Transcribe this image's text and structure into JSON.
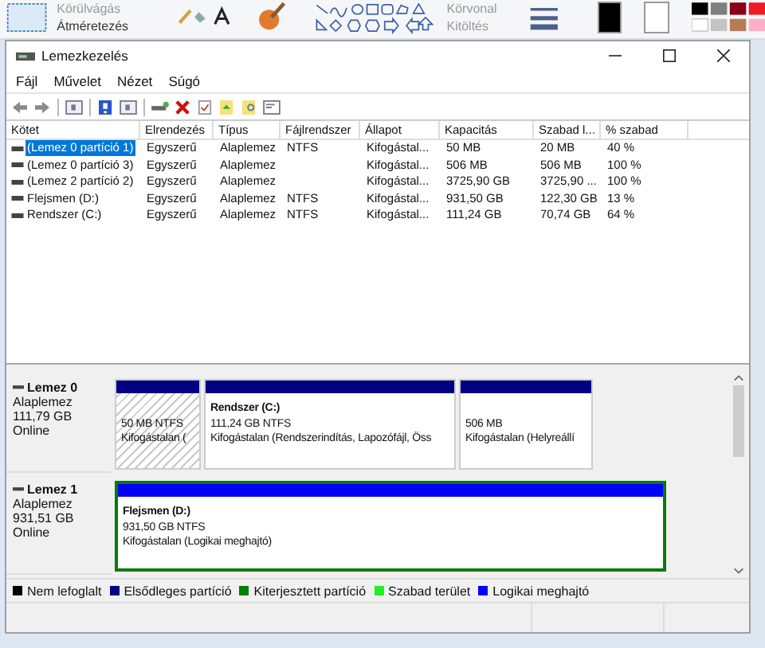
{
  "background_ribbon": {
    "texts": [
      "Körülvágás",
      "Átméretezés",
      "Körvonal",
      "Kitöltés"
    ]
  },
  "window": {
    "title": "Lemezkezelés"
  },
  "menu": [
    "Fájl",
    "Művelet",
    "Nézet",
    "Súgó"
  ],
  "volume_table": {
    "columns": [
      "Kötet",
      "Elrendezés",
      "Típus",
      "Fájlrendszer",
      "Állapot",
      "Kapacitás",
      "Szabad l...",
      "% szabad"
    ],
    "rows": [
      {
        "selected": true,
        "cells": [
          "(Lemez 0 partíció 1)",
          "Egyszerű",
          "Alaplemez",
          "NTFS",
          "Kifogástal...",
          "50 MB",
          "20 MB",
          "40 %"
        ]
      },
      {
        "selected": false,
        "cells": [
          "(Lemez 0 partíció 3)",
          "Egyszerű",
          "Alaplemez",
          "",
          "Kifogástal...",
          "506 MB",
          "506 MB",
          "100 %"
        ]
      },
      {
        "selected": false,
        "cells": [
          "(Lemez 2 partíció 2)",
          "Egyszerű",
          "Alaplemez",
          "",
          "Kifogástal...",
          "3725,90 GB",
          "3725,90 ...",
          "100 %"
        ]
      },
      {
        "selected": false,
        "cells": [
          "Flejsmen (D:)",
          "Egyszerű",
          "Alaplemez",
          "NTFS",
          "Kifogástal...",
          "931,50 GB",
          "122,30 GB",
          "13 %"
        ]
      },
      {
        "selected": false,
        "cells": [
          "Rendszer (C:)",
          "Egyszerű",
          "Alaplemez",
          "NTFS",
          "Kifogástal...",
          "111,24 GB",
          "70,74 GB",
          "64 %"
        ]
      }
    ]
  },
  "disks": [
    {
      "name": "Lemez 0",
      "type": "Alaplemez",
      "size": "111,79 GB",
      "status": "Online",
      "partitions": [
        {
          "kind": "primary",
          "selected": true,
          "size_fs": "50 MB NTFS",
          "status": "Kifogástalan ("
        },
        {
          "kind": "primary",
          "selected": false,
          "label": "Rendszer  (C:)",
          "size_fs": "111,24 GB NTFS",
          "status": "Kifogástalan (Rendszerindítás, Lapozófájl, Öss"
        },
        {
          "kind": "primary",
          "selected": false,
          "size_fs": "506 MB",
          "status": "Kifogástalan (Helyreállí"
        }
      ]
    },
    {
      "name": "Lemez 1",
      "type": "Alaplemez",
      "size": "931,51 GB",
      "status": "Online",
      "partitions": [
        {
          "kind": "extended",
          "children": [
            {
              "kind": "logical",
              "selected": false,
              "label": "Flejsmen  (D:)",
              "size_fs": "931,50 GB NTFS",
              "status": "Kifogástalan (Logikai meghajtó)"
            }
          ]
        }
      ]
    }
  ],
  "legend": [
    {
      "label": "Nem lefoglalt",
      "color": "#000000"
    },
    {
      "label": "Elsődleges partíció",
      "color": "#000080"
    },
    {
      "label": "Kiterjesztett partíció",
      "color": "#008000"
    },
    {
      "label": "Szabad terület",
      "color": "#22ee22"
    },
    {
      "label": "Logikai meghajtó",
      "color": "#0000ff"
    }
  ]
}
